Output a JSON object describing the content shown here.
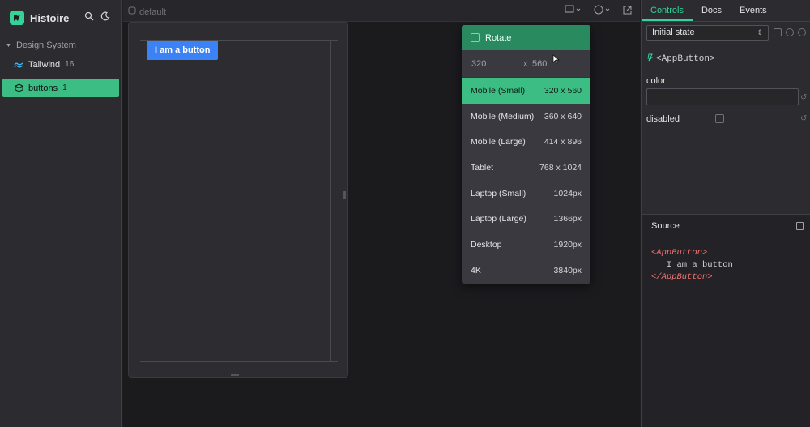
{
  "sidebar": {
    "brand": "Histoire",
    "folder": "Design System",
    "items": [
      {
        "label": "Tailwind",
        "count": "16"
      },
      {
        "label": "buttons",
        "count": "1"
      }
    ]
  },
  "topbar": {
    "variant": "default"
  },
  "preview": {
    "button_label": "I am a button"
  },
  "responsive_menu": {
    "rotate_label": "Rotate",
    "width": "320",
    "x": "x",
    "height": "560",
    "presets": [
      {
        "name": "Mobile (Small)",
        "size": "320 x 560"
      },
      {
        "name": "Mobile (Medium)",
        "size": "360 x 640"
      },
      {
        "name": "Mobile (Large)",
        "size": "414 x 896"
      },
      {
        "name": "Tablet",
        "size": "768 x 1024"
      },
      {
        "name": "Laptop (Small)",
        "size": "1024px"
      },
      {
        "name": "Laptop (Large)",
        "size": "1366px"
      },
      {
        "name": "Desktop",
        "size": "1920px"
      },
      {
        "name": "4K",
        "size": "3840px"
      }
    ]
  },
  "panel": {
    "tabs": [
      "Controls",
      "Docs",
      "Events"
    ],
    "state": "Initial state",
    "component": "<AppButton>",
    "controls": {
      "color_label": "color",
      "disabled_label": "disabled"
    },
    "source": {
      "title": "Source",
      "line1_tag": "<AppButton>",
      "line2": "   I am a button",
      "line3_tag": "</AppButton>"
    }
  },
  "colors": {
    "accent": "#3bbd84",
    "button": "#3b82f6",
    "tag": "#f87171"
  }
}
